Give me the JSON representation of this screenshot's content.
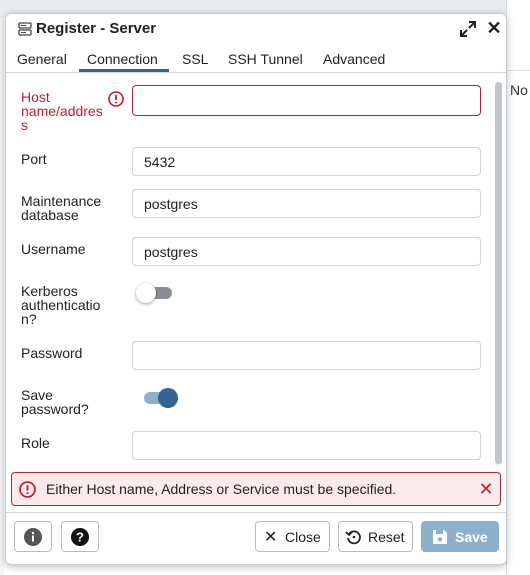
{
  "background": {
    "right_text": "No"
  },
  "dialog": {
    "title": "Register - Server",
    "tabs": [
      {
        "label": "General",
        "active": false
      },
      {
        "label": "Connection",
        "active": true
      },
      {
        "label": "SSL",
        "active": false
      },
      {
        "label": "SSH Tunnel",
        "active": false
      },
      {
        "label": "Advanced",
        "active": false
      }
    ],
    "fields": {
      "host": {
        "label_lines": [
          "Host",
          "name/addres",
          "s"
        ],
        "value": "",
        "error": true
      },
      "port": {
        "label": "Port",
        "value": "5432"
      },
      "maintenance_db": {
        "label_lines": [
          "Maintenance",
          "database"
        ],
        "value": "postgres"
      },
      "username": {
        "label": "Username",
        "value": "postgres"
      },
      "kerberos": {
        "label_lines": [
          "Kerberos",
          "authenticatio",
          "n?"
        ],
        "enabled": false
      },
      "password": {
        "label": "Password",
        "value": ""
      },
      "save_password": {
        "label_lines": [
          "Save",
          "password?"
        ],
        "enabled": true
      },
      "role": {
        "label": "Role",
        "value": ""
      }
    },
    "error_message": "Either Host name, Address or Service must be specified.",
    "footer": {
      "close_label": "Close",
      "reset_label": "Reset",
      "save_label": "Save"
    }
  },
  "colors": {
    "accent": "#326690",
    "error": "#c41c2c",
    "save_disabled": "#8db0cc"
  }
}
